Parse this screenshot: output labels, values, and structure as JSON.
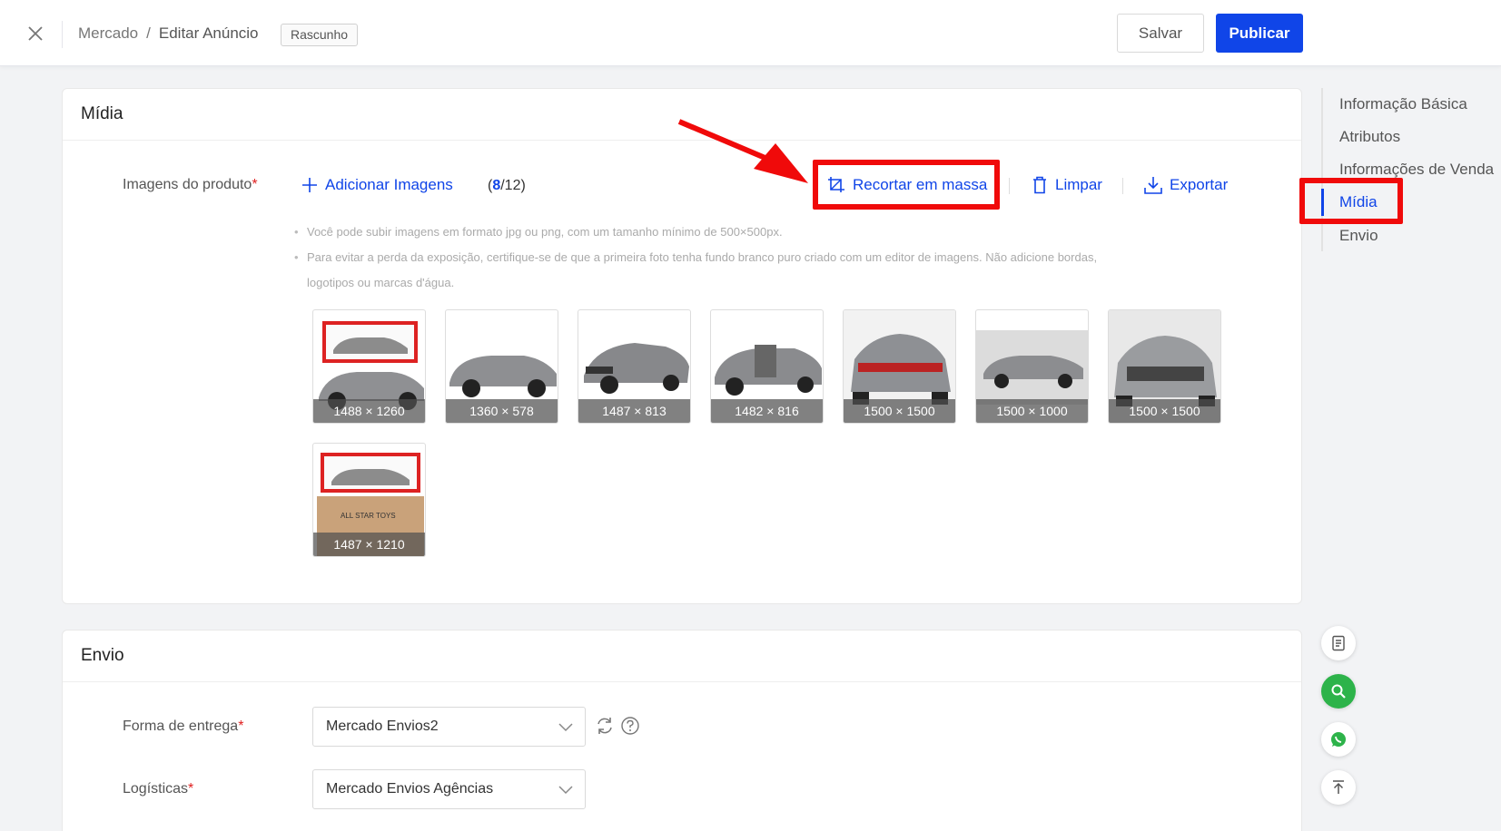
{
  "header": {
    "breadcrumb_root": "Mercado",
    "breadcrumb_sep": "/",
    "breadcrumb_current": "Editar Anúncio",
    "status_badge": "Rascunho",
    "save_label": "Salvar",
    "publish_label": "Publicar"
  },
  "media": {
    "title": "Mídia",
    "images_label": "Imagens do produto",
    "required_mark": "*",
    "add_images_label": "Adicionar Imagens",
    "count_open": "(",
    "count_current": "8",
    "count_rest": "/12)",
    "bulk_crop_label": "Recortar em massa",
    "clear_label": "Limpar",
    "export_label": "Exportar",
    "hints": [
      "Você pode subir imagens em formato jpg ou png, com um tamanho mínimo de 500×500px.",
      "Para evitar a perda da exposição, certifique-se de que a primeira foto tenha fundo branco puro criado com um editor de imagens. Não adicione bordas,",
      "logotipos ou marcas d'água."
    ],
    "images": [
      {
        "dimensions": "1488 × 1260",
        "subject": "boxed model car with car below"
      },
      {
        "dimensions": "1360 × 578",
        "subject": "gray car side view"
      },
      {
        "dimensions": "1487 × 813",
        "subject": "gray car front three-quarter"
      },
      {
        "dimensions": "1482 × 816",
        "subject": "gray car open doors"
      },
      {
        "dimensions": "1500 × 1500",
        "subject": "gray car rear view"
      },
      {
        "dimensions": "1500 × 1000",
        "subject": "gray car side on gray background"
      },
      {
        "dimensions": "1500 × 1500",
        "subject": "gray car front view"
      },
      {
        "dimensions": "1487 × 1210",
        "subject": "boxed model car on cardboard box"
      }
    ],
    "box_print": "ALL STAR TOYS"
  },
  "shipping": {
    "title": "Envio",
    "delivery_label": "Forma de entrega",
    "delivery_value": "Mercado Envios2",
    "logistics_label": "Logísticas",
    "logistics_value": "Mercado Envios Agências"
  },
  "side_nav": {
    "items": [
      "Informação Básica",
      "Atributos",
      "Informações de Venda",
      "Mídia",
      "Envio"
    ],
    "active": "Mídia"
  },
  "colors": {
    "accent": "#1045e8",
    "highlight": "#f00a0a",
    "whatsapp": "#2db34a"
  }
}
